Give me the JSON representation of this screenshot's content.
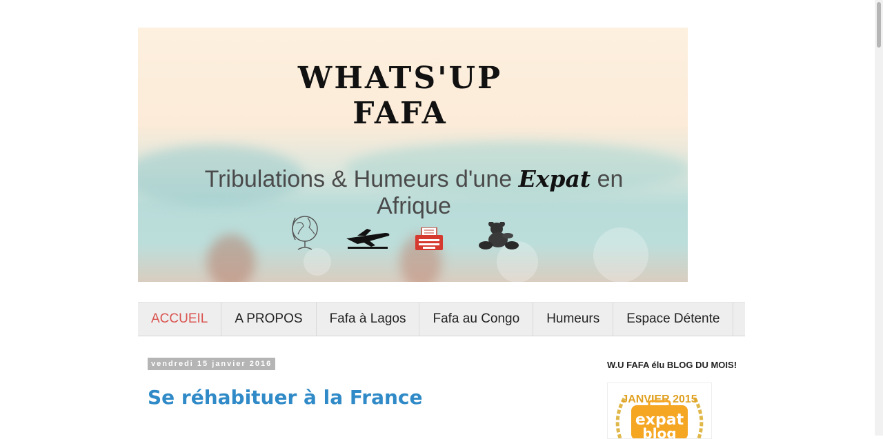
{
  "header": {
    "title": "WHATS'UP FAFA",
    "tagline_prefix": "Tribulations & Humeurs d'une ",
    "tagline_emphasis": "Expat",
    "tagline_suffix": " en Afrique",
    "icons": [
      "globe-icon",
      "airplane-icon",
      "typewriter-icon",
      "teddy-bear-icon"
    ]
  },
  "nav": {
    "items": [
      {
        "label": "ACCUEIL"
      },
      {
        "label": "A PROPOS"
      },
      {
        "label": "Fafa à Lagos"
      },
      {
        "label": "Fafa au Congo"
      },
      {
        "label": "Humeurs"
      },
      {
        "label": "Espace Détente"
      }
    ]
  },
  "post": {
    "date": "vendredi 15 janvier 2016",
    "title": "Se réhabituer à la France"
  },
  "sidebar": {
    "heading": "W.U FAFA élu BLOG DU MOIS!",
    "badge_top": "JANVIER 2015",
    "badge_word1": "expat",
    "badge_word2": "blog"
  },
  "colors": {
    "nav_active": "#d9534f",
    "post_title": "#2f8ac7",
    "badge_orange": "#f5a623"
  }
}
